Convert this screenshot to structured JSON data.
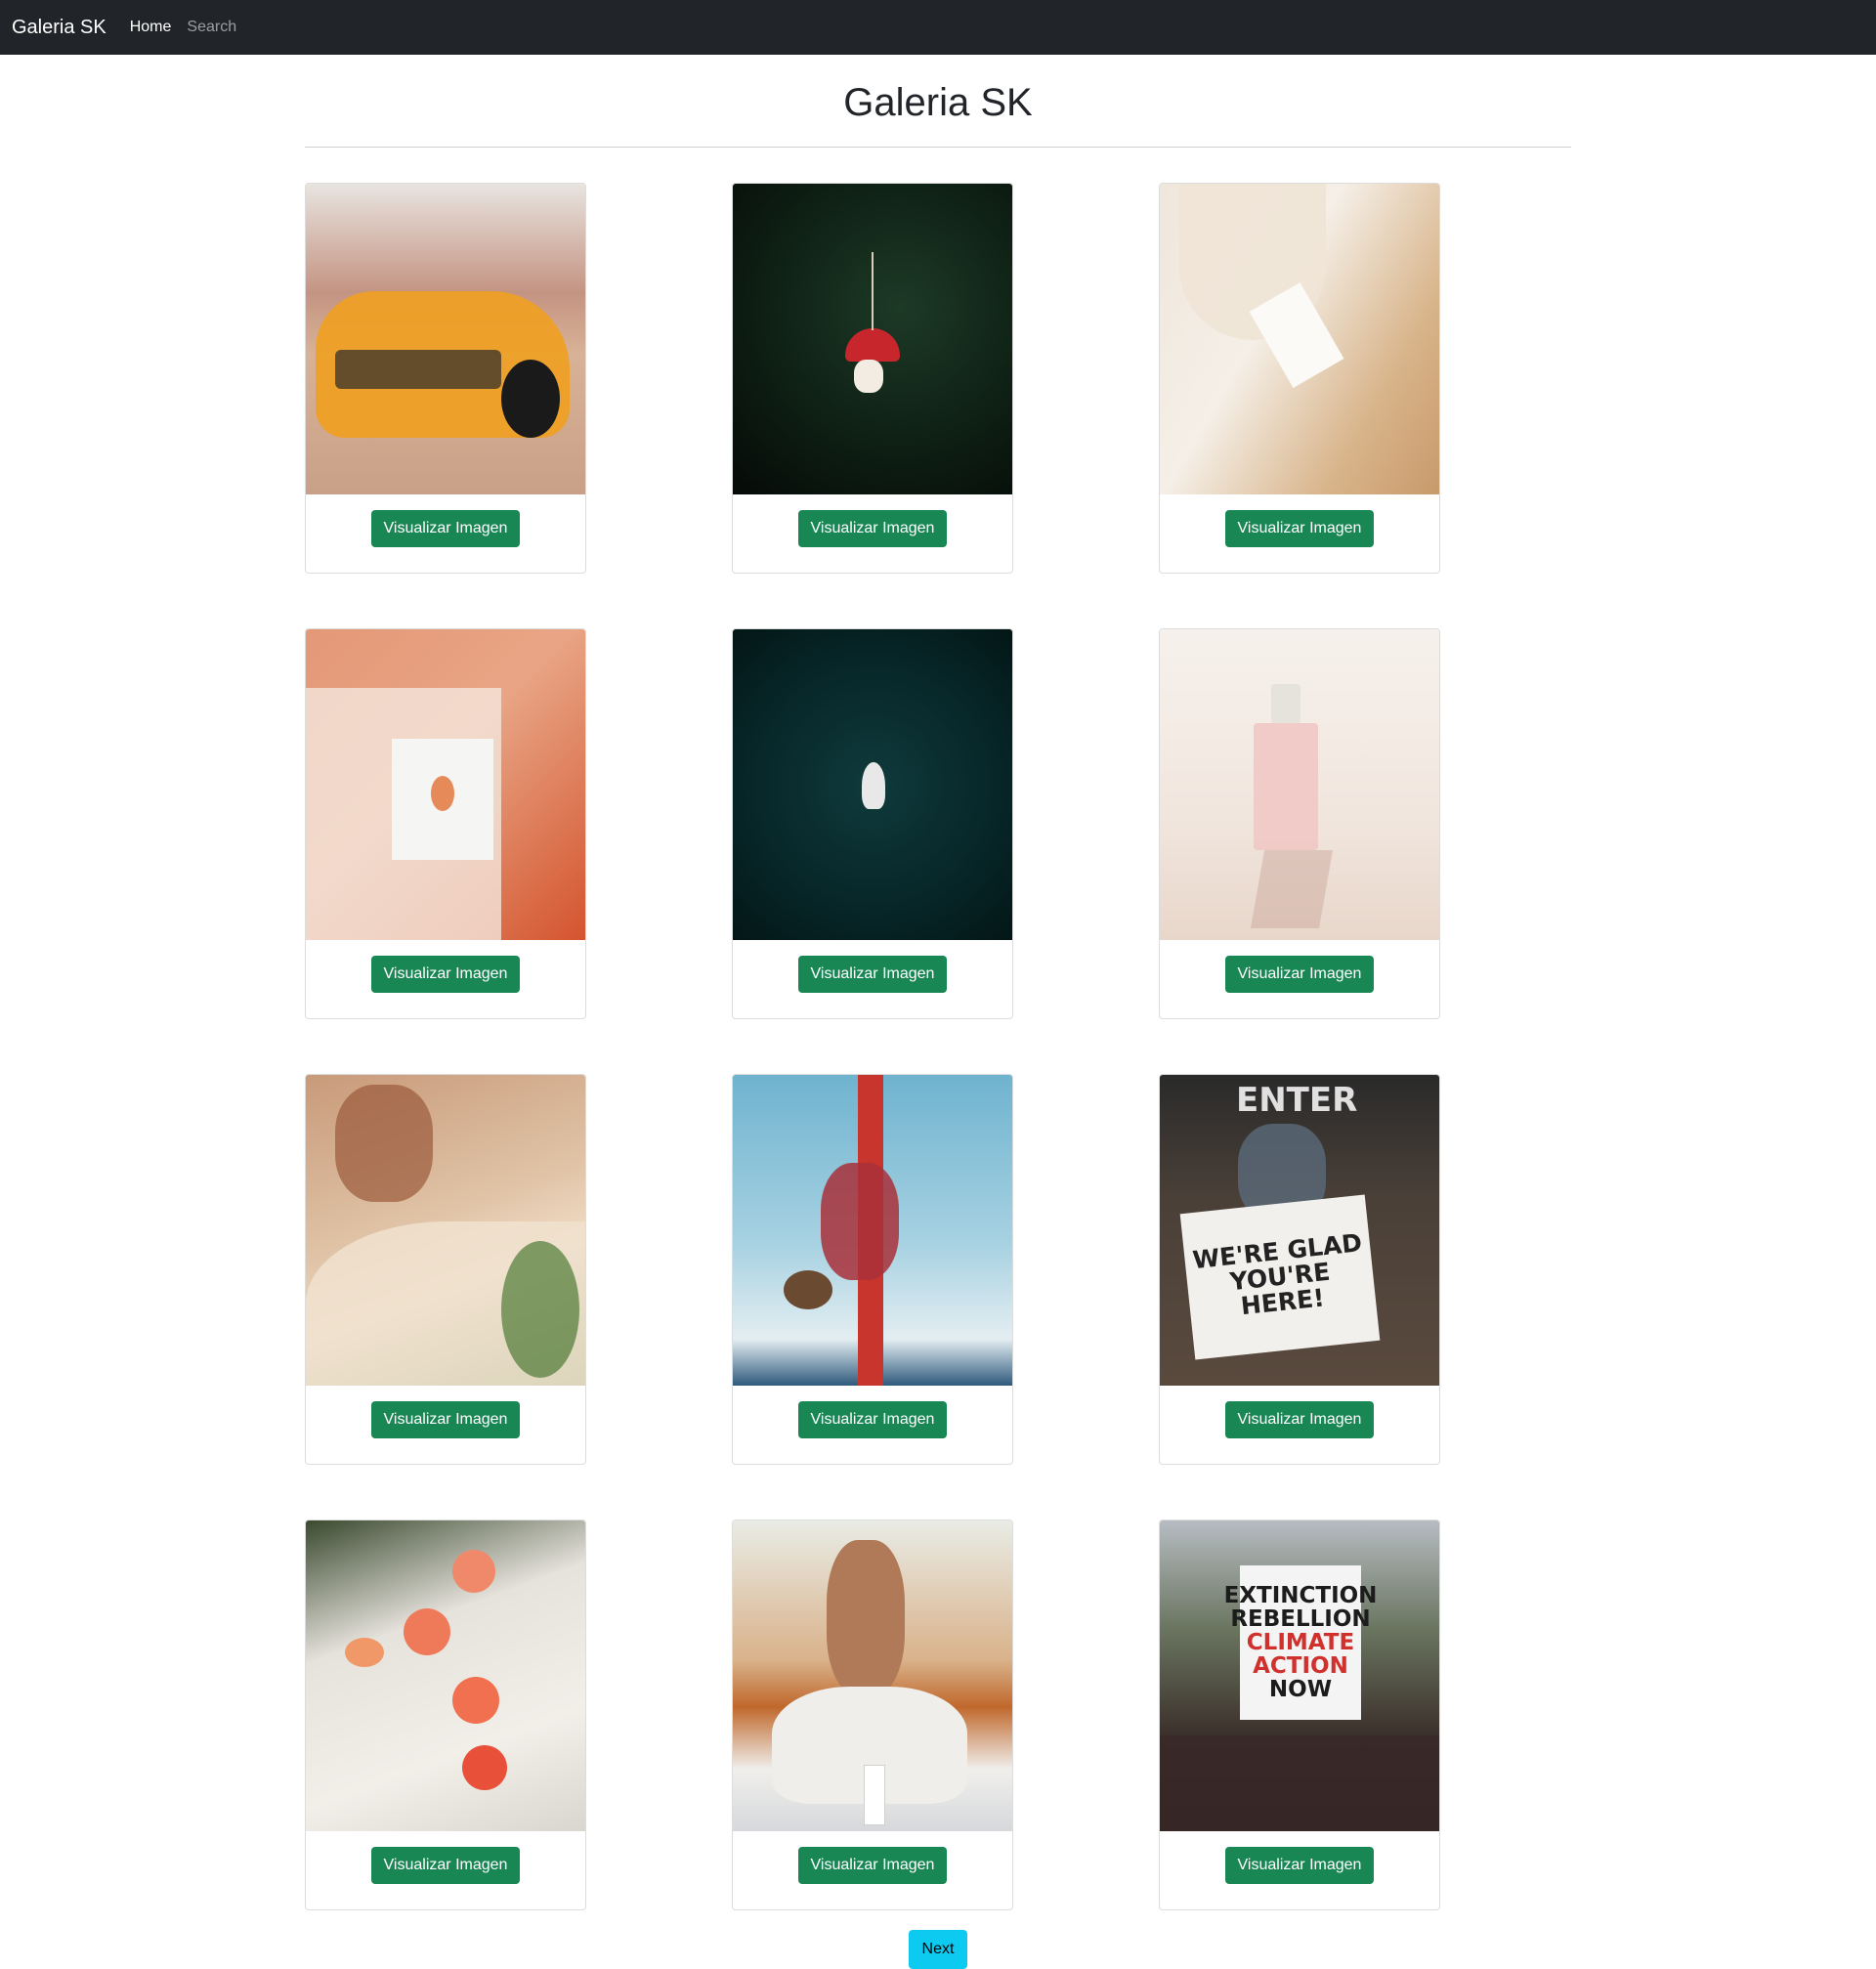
{
  "navbar": {
    "brand": "Galeria SK",
    "links": [
      {
        "label": "Home",
        "active": true
      },
      {
        "label": "Search",
        "active": false
      }
    ]
  },
  "page": {
    "title": "Galeria SK"
  },
  "gallery": {
    "button_label": "Visualizar Imagen",
    "items": [
      {
        "image": "orange-sports-car"
      },
      {
        "image": "mushroom-ornament-on-tree"
      },
      {
        "image": "white-petals-and-jar"
      },
      {
        "image": "hand-holding-card-against-wall"
      },
      {
        "image": "boat-on-dark-sea"
      },
      {
        "image": "perfume-bottle"
      },
      {
        "image": "woman-painting-surfboard"
      },
      {
        "image": "aerial-silk-acrobat"
      },
      {
        "image": "woman-with-sign"
      },
      {
        "image": "orange-flowers"
      },
      {
        "image": "woman-kneeling-yoga"
      },
      {
        "image": "climate-protest"
      }
    ],
    "sign_text": {
      "enter": "ENTER",
      "lines": [
        "WE'RE GLAD",
        "YOU'RE",
        "HERE!"
      ]
    },
    "protest_text": {
      "black_lines": [
        "EXTINCTION",
        "REBELLION"
      ],
      "red_lines": [
        "CLIMATE",
        "ACTION"
      ],
      "last_line": "NOW"
    }
  },
  "pagination": {
    "next_label": "Next"
  },
  "colors": {
    "navbar_bg": "#212529",
    "button_success": "#198754",
    "button_info": "#0dcaf0"
  }
}
